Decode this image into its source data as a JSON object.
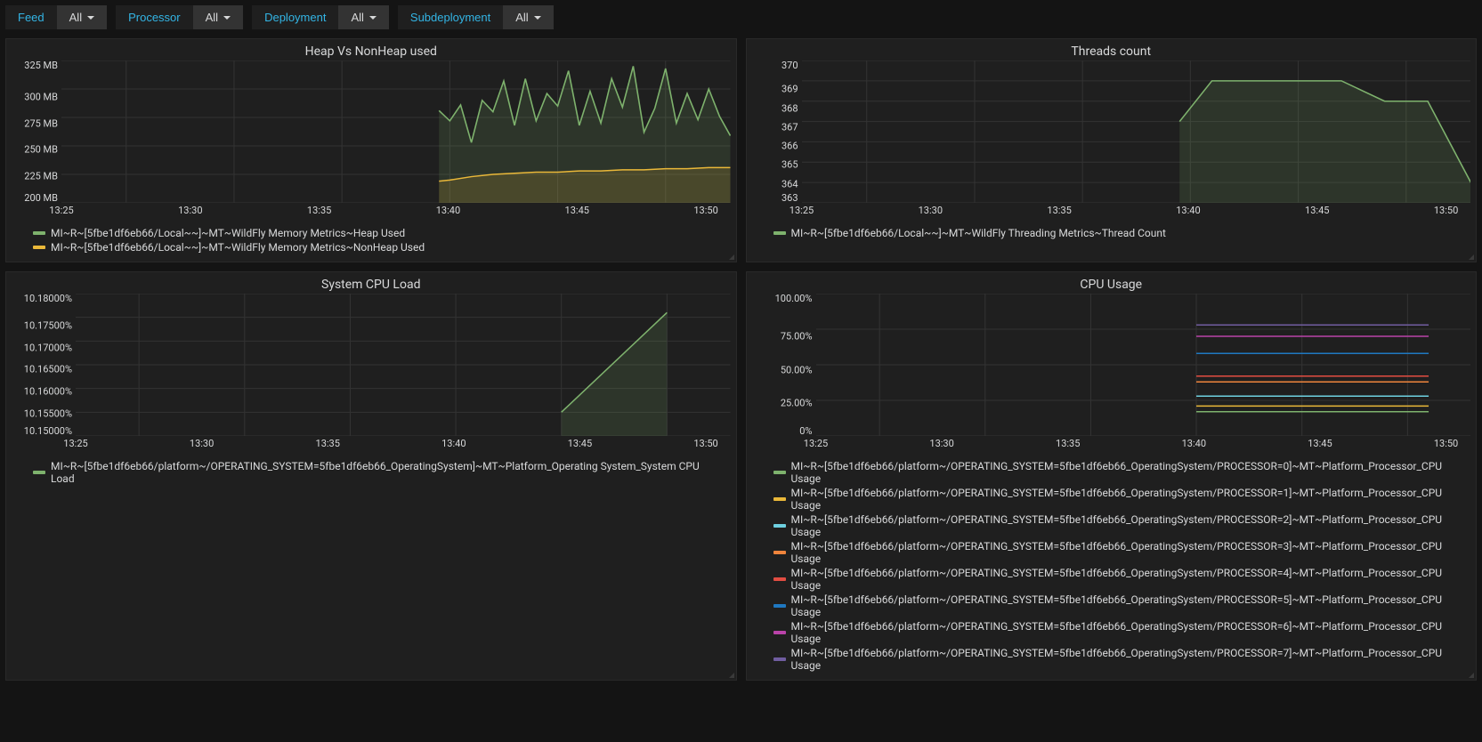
{
  "toolbar": {
    "filters": [
      {
        "label": "Feed",
        "value": "All"
      },
      {
        "label": "Processor",
        "value": "All"
      },
      {
        "label": "Deployment",
        "value": "All"
      },
      {
        "label": "Subdeployment",
        "value": "All"
      }
    ]
  },
  "chart_data": [
    {
      "id": "heap",
      "type": "area",
      "title": "Heap Vs NonHeap used",
      "xlabel": "",
      "ylabel": "",
      "x_ticks": [
        "13:25",
        "13:30",
        "13:35",
        "13:40",
        "13:45",
        "13:50"
      ],
      "y_ticks": [
        "325 MB",
        "300 MB",
        "275 MB",
        "250 MB",
        "225 MB",
        "200 MB"
      ],
      "ylim": [
        200,
        325
      ],
      "xlim_minutes": [
        22,
        53
      ],
      "series": [
        {
          "name": "MI~R~[5fbe1df6eb66/Local~~]~MT~WildFly Memory Metrics~Heap Used",
          "color": "#7eb26d",
          "x": [
            39.5,
            40,
            40.5,
            41,
            41.5,
            42,
            42.5,
            43,
            43.5,
            44,
            44.5,
            45,
            45.5,
            46,
            46.5,
            47,
            47.5,
            48,
            48.5,
            49,
            49.5,
            50,
            50.5,
            51,
            51.5,
            52,
            52.5,
            53
          ],
          "y": [
            281,
            272,
            286,
            253,
            290,
            280,
            307,
            268,
            309,
            272,
            296,
            285,
            316,
            268,
            298,
            270,
            309,
            284,
            320,
            262,
            283,
            318,
            270,
            296,
            273,
            300,
            276,
            259
          ]
        },
        {
          "name": "MI~R~[5fbe1df6eb66/Local~~]~MT~WildFly Memory Metrics~NonHeap Used",
          "color": "#eab839",
          "x": [
            39.5,
            40,
            41,
            42,
            43,
            44,
            45,
            46,
            47,
            48,
            49,
            50,
            51,
            52,
            53
          ],
          "y": [
            219,
            220,
            223,
            225,
            226,
            227,
            227,
            228,
            228,
            229,
            229,
            230,
            230,
            231,
            231
          ]
        }
      ]
    },
    {
      "id": "threads",
      "type": "line",
      "title": "Threads count",
      "x_ticks": [
        "13:25",
        "13:30",
        "13:35",
        "13:40",
        "13:45",
        "13:50"
      ],
      "y_ticks": [
        "370",
        "369",
        "368",
        "367",
        "366",
        "365",
        "364",
        "363"
      ],
      "ylim": [
        363,
        370
      ],
      "xlim_minutes": [
        22,
        53
      ],
      "series": [
        {
          "name": "MI~R~[5fbe1df6eb66/Local~~]~MT~WildFly Threading Metrics~Thread Count",
          "color": "#7eb26d",
          "x": [
            39.5,
            41,
            43,
            45,
            47,
            49,
            50,
            51,
            53
          ],
          "y": [
            367,
            369,
            369,
            369,
            369,
            368,
            368,
            368,
            364
          ]
        }
      ]
    },
    {
      "id": "sysload",
      "type": "area",
      "title": "System CPU Load",
      "x_ticks": [
        "13:25",
        "13:30",
        "13:35",
        "13:40",
        "13:45",
        "13:50"
      ],
      "y_ticks": [
        "10.18000%",
        "10.17500%",
        "10.17000%",
        "10.16500%",
        "10.16000%",
        "10.15500%",
        "10.15000%"
      ],
      "ylim": [
        10.15,
        10.18
      ],
      "xlim_minutes": [
        22,
        53
      ],
      "series": [
        {
          "name": "MI~R~[5fbe1df6eb66/platform~/OPERATING_SYSTEM=5fbe1df6eb66_OperatingSystem]~MT~Platform_Operating System_System CPU Load",
          "color": "#7eb26d",
          "x": [
            45,
            50
          ],
          "y": [
            10.155,
            10.176
          ]
        }
      ]
    },
    {
      "id": "cpu",
      "type": "line",
      "title": "CPU Usage",
      "x_ticks": [
        "13:25",
        "13:30",
        "13:35",
        "13:40",
        "13:45",
        "13:50"
      ],
      "y_ticks": [
        "100.00%",
        "75.00%",
        "50.00%",
        "25.00%",
        "0%"
      ],
      "ylim": [
        0,
        100
      ],
      "xlim_minutes": [
        22,
        53
      ],
      "series": [
        {
          "name": "MI~R~[5fbe1df6eb66/platform~/OPERATING_SYSTEM=5fbe1df6eb66_OperatingSystem/PROCESSOR=0]~MT~Platform_Processor_CPU Usage",
          "color": "#7eb26d",
          "x": [
            40,
            51
          ],
          "y": [
            17,
            17
          ]
        },
        {
          "name": "MI~R~[5fbe1df6eb66/platform~/OPERATING_SYSTEM=5fbe1df6eb66_OperatingSystem/PROCESSOR=1]~MT~Platform_Processor_CPU Usage",
          "color": "#eab839",
          "x": [
            40,
            51
          ],
          "y": [
            21,
            21
          ]
        },
        {
          "name": "MI~R~[5fbe1df6eb66/platform~/OPERATING_SYSTEM=5fbe1df6eb66_OperatingSystem/PROCESSOR=2]~MT~Platform_Processor_CPU Usage",
          "color": "#6ed0e0",
          "x": [
            40,
            51
          ],
          "y": [
            28,
            28
          ]
        },
        {
          "name": "MI~R~[5fbe1df6eb66/platform~/OPERATING_SYSTEM=5fbe1df6eb66_OperatingSystem/PROCESSOR=3]~MT~Platform_Processor_CPU Usage",
          "color": "#ef843c",
          "x": [
            40,
            51
          ],
          "y": [
            38,
            38
          ]
        },
        {
          "name": "MI~R~[5fbe1df6eb66/platform~/OPERATING_SYSTEM=5fbe1df6eb66_OperatingSystem/PROCESSOR=4]~MT~Platform_Processor_CPU Usage",
          "color": "#e24d42",
          "x": [
            40,
            51
          ],
          "y": [
            42,
            42
          ]
        },
        {
          "name": "MI~R~[5fbe1df6eb66/platform~/OPERATING_SYSTEM=5fbe1df6eb66_OperatingSystem/PROCESSOR=5]~MT~Platform_Processor_CPU Usage",
          "color": "#1f78c1",
          "x": [
            40,
            51
          ],
          "y": [
            58,
            58
          ]
        },
        {
          "name": "MI~R~[5fbe1df6eb66/platform~/OPERATING_SYSTEM=5fbe1df6eb66_OperatingSystem/PROCESSOR=6]~MT~Platform_Processor_CPU Usage",
          "color": "#ba43a9",
          "x": [
            40,
            51
          ],
          "y": [
            70,
            70
          ]
        },
        {
          "name": "MI~R~[5fbe1df6eb66/platform~/OPERATING_SYSTEM=5fbe1df6eb66_OperatingSystem/PROCESSOR=7]~MT~Platform_Processor_CPU Usage",
          "color": "#705da0",
          "x": [
            40,
            51
          ],
          "y": [
            78,
            78
          ]
        }
      ]
    }
  ]
}
